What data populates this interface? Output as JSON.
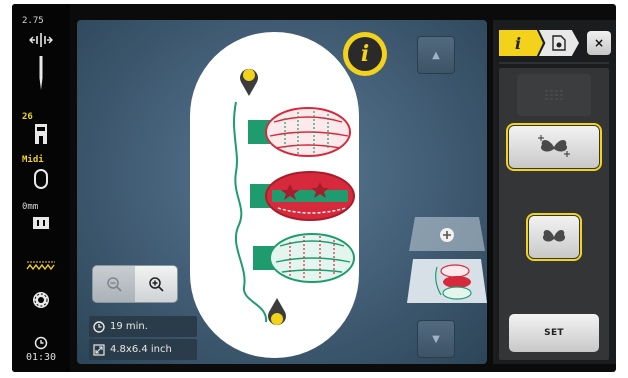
{
  "status_bar": {
    "stitch_width": "2.75",
    "needle_position": "26",
    "presser_foot": "Midi",
    "stitch_length": "0mm",
    "time": "01:30"
  },
  "embroidery": {
    "info_icon_glyph": "i",
    "duration": "19 min.",
    "size": "4.8x6.4 inch",
    "colors": {
      "red": "#d6293b",
      "green": "#1f9c6e",
      "accent": "#f2d21a"
    }
  },
  "right_panel": {
    "tab_info_glyph": "i",
    "close_glyph": "×",
    "set_label": "SET"
  }
}
